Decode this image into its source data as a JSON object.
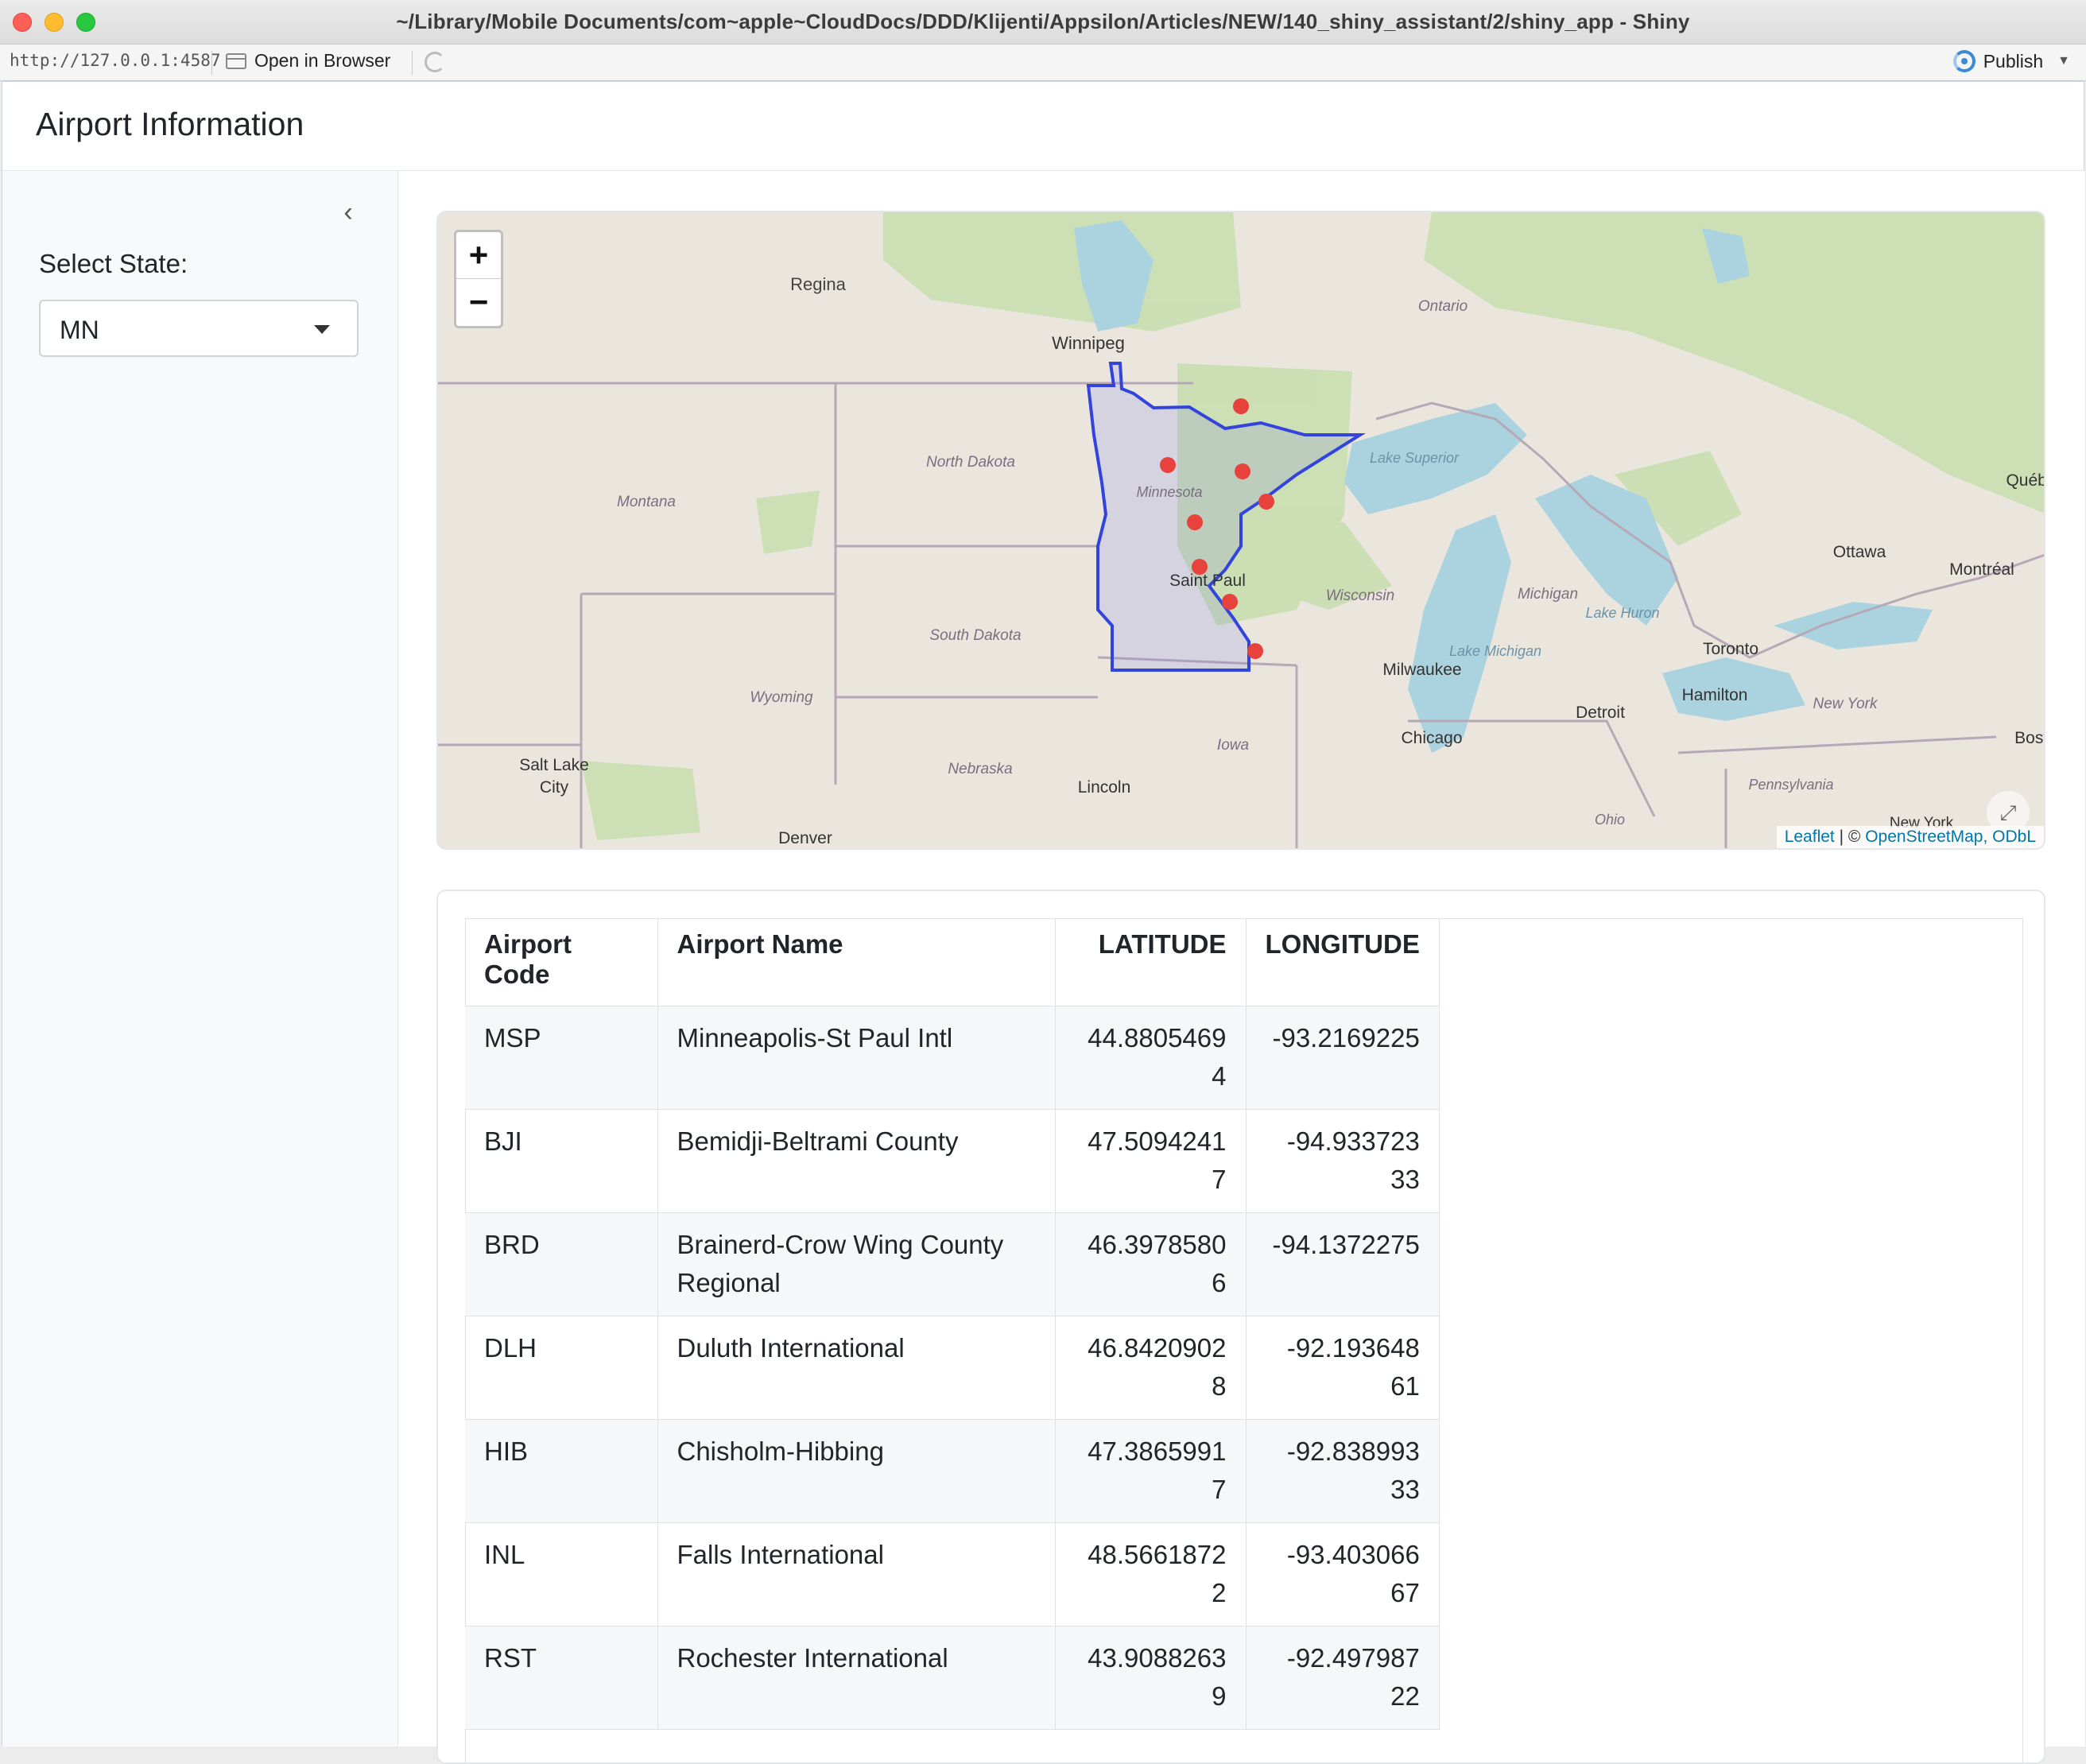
{
  "window": {
    "title": "~/Library/Mobile Documents/com~apple~CloudDocs/DDD/Klijenti/Appsilon/Articles/NEW/140_shiny_assistant/2/shiny_app - Shiny"
  },
  "toolbar": {
    "url": "http://127.0.0.1:4587",
    "open_in_browser": "Open in Browser",
    "publish": "Publish"
  },
  "app": {
    "title": "Airport Information",
    "sidebar": {
      "select_label": "Select State:",
      "selected_state": "MN"
    }
  },
  "map": {
    "zoom_in": "+",
    "zoom_out": "−",
    "attribution": {
      "leaflet": "Leaflet",
      "sep": " | © ",
      "osm": "OpenStreetMap",
      "odbl": ", ODbL"
    },
    "place_labels": [
      "Regina",
      "Winnipeg",
      "Ontario",
      "North Dakota",
      "Montana",
      "Lake Superior",
      "Minnesota",
      "Saint Paul",
      "Wisconsin",
      "Michigan",
      "Lake Huron",
      "Ottawa",
      "Montréal",
      "Québe",
      "South Dakota",
      "Toronto",
      "Hamilton",
      "Lake Michigan",
      "Milwaukee",
      "Wyoming",
      "Detroit",
      "New York",
      "Iowa",
      "Chicago",
      "Nebraska",
      "Salt Lake",
      "City",
      "Lincoln",
      "Pennsylvania",
      "Denver",
      "Ohio",
      "Bosto",
      "New York"
    ]
  },
  "table": {
    "headers": [
      "Airport Code",
      "Airport Name",
      "LATITUDE",
      "LONGITUDE"
    ],
    "rows": [
      [
        "MSP",
        "Minneapolis-St Paul Intl",
        "44.8805469 4",
        "-93.2169225"
      ],
      [
        "BJI",
        "Bemidji-Beltrami County",
        "47.5094241 7",
        "-94.933723 33"
      ],
      [
        "BRD",
        "Brainerd-Crow Wing County Regional",
        "46.3978580 6",
        "-94.1372275"
      ],
      [
        "DLH",
        "Duluth International",
        "46.8420902 8",
        "-92.193648 61"
      ],
      [
        "HIB",
        "Chisholm-Hibbing",
        "47.3865991 7",
        "-92.838993 33"
      ],
      [
        "INL",
        "Falls International",
        "48.5661872 2",
        "-93.403066 67"
      ],
      [
        "RST",
        "Rochester International",
        "43.9088263 9",
        "-92.497987 22"
      ]
    ]
  },
  "colors": {
    "marker": "#e8423c",
    "state_outline": "#3344dd",
    "water": "#aad3df",
    "land": "#f2efe9"
  }
}
